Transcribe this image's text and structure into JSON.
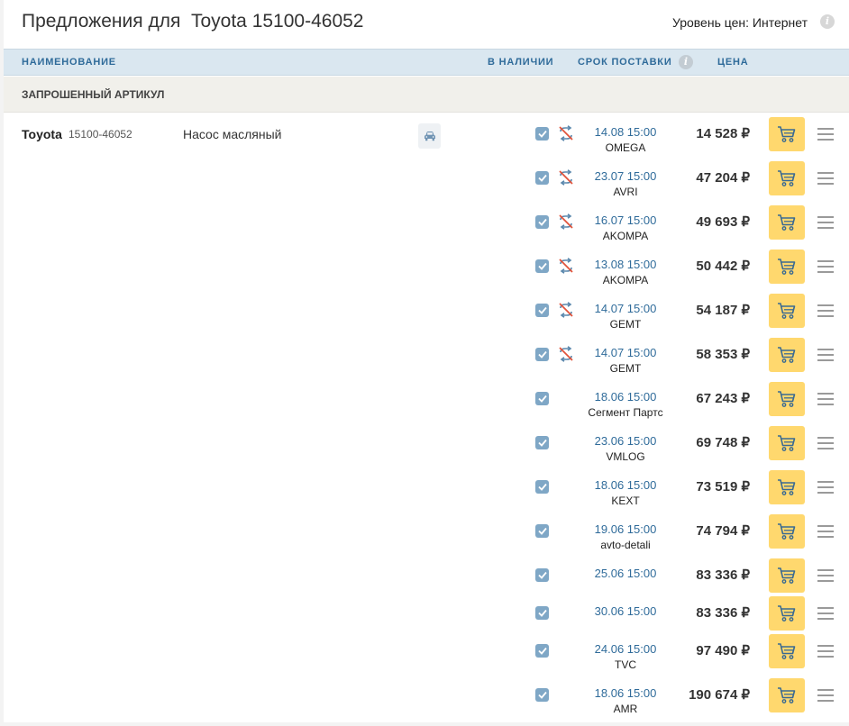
{
  "header": {
    "title": "Предложения для  Toyota 15100-46052",
    "price_level": "Уровень цен: Интернет"
  },
  "columns": {
    "name": "НАИМЕНОВАНИЕ",
    "stock": "В НАЛИЧИИ",
    "delivery": "СРОК ПОСТАВКИ",
    "price": "ЦЕНА"
  },
  "section": {
    "label": "ЗАПРОШЕННЫЙ АРТИКУЛ"
  },
  "part": {
    "brand": "Toyota",
    "article": "15100-46052",
    "description": "Насос масляный"
  },
  "colors": {
    "cart": "#ffd86e",
    "header_bg": "#dae7f0",
    "link": "#2f6b9a",
    "no_return_icon_red": "#e0533b"
  },
  "offers": [
    {
      "date": "14.08 15:00",
      "supplier": "OMEGA",
      "price": "14 528 ₽",
      "in_stock": true,
      "no_return": true
    },
    {
      "date": "23.07 15:00",
      "supplier": "AVRI",
      "price": "47 204 ₽",
      "in_stock": true,
      "no_return": true
    },
    {
      "date": "16.07 15:00",
      "supplier": "AKOMPA",
      "price": "49 693 ₽",
      "in_stock": true,
      "no_return": true
    },
    {
      "date": "13.08 15:00",
      "supplier": "AKOMPA",
      "price": "50 442 ₽",
      "in_stock": true,
      "no_return": true
    },
    {
      "date": "14.07 15:00",
      "supplier": "GEMT",
      "price": "54 187 ₽",
      "in_stock": true,
      "no_return": true
    },
    {
      "date": "14.07 15:00",
      "supplier": "GEMT",
      "price": "58 353 ₽",
      "in_stock": true,
      "no_return": true
    },
    {
      "date": "18.06 15:00",
      "supplier": "Сегмент Партс",
      "price": "67 243 ₽",
      "in_stock": true,
      "no_return": false
    },
    {
      "date": "23.06 15:00",
      "supplier": "VMLOG",
      "price": "69 748 ₽",
      "in_stock": true,
      "no_return": false
    },
    {
      "date": "18.06 15:00",
      "supplier": "KEXT",
      "price": "73 519 ₽",
      "in_stock": true,
      "no_return": false
    },
    {
      "date": "19.06 15:00",
      "supplier": "avto-detali",
      "price": "74 794 ₽",
      "in_stock": true,
      "no_return": false
    },
    {
      "date": "25.06 15:00",
      "supplier": "",
      "price": "83 336 ₽",
      "in_stock": true,
      "no_return": false
    },
    {
      "date": "30.06 15:00",
      "supplier": "",
      "price": "83 336 ₽",
      "in_stock": true,
      "no_return": false
    },
    {
      "date": "24.06 15:00",
      "supplier": "TVC",
      "price": "97 490 ₽",
      "in_stock": true,
      "no_return": false
    },
    {
      "date": "18.06 15:00",
      "supplier": "AMR",
      "price": "190 674 ₽",
      "in_stock": true,
      "no_return": false
    }
  ]
}
